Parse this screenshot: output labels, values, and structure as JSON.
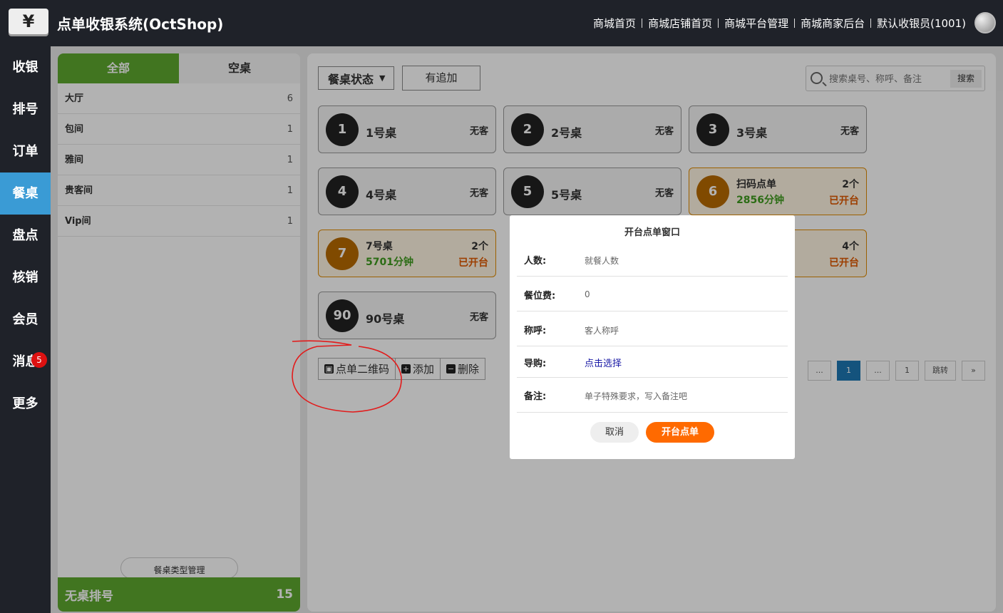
{
  "app": {
    "logo": "¥",
    "title": "点单收银系统(OctShop)"
  },
  "top_links": [
    "商城首页",
    "商城店铺首页",
    "商城平台管理",
    "商城商家后台",
    "默认收银员(1001)"
  ],
  "nav": [
    {
      "label": "收银"
    },
    {
      "label": "排号"
    },
    {
      "label": "订单"
    },
    {
      "label": "餐桌",
      "active": true
    },
    {
      "label": "盘点"
    },
    {
      "label": "核销"
    },
    {
      "label": "会员"
    },
    {
      "label": "消息",
      "badge": "5"
    },
    {
      "label": "更多"
    }
  ],
  "left_panel": {
    "tabs": [
      "全部",
      "空桌"
    ],
    "categories": [
      {
        "name": "大厅",
        "count": "6"
      },
      {
        "name": "包间",
        "count": "1"
      },
      {
        "name": "雅间",
        "count": "1"
      },
      {
        "name": "贵客间",
        "count": "1"
      },
      {
        "name": "Vip间",
        "count": "1"
      }
    ],
    "type_manage": "餐桌类型管理",
    "no_table_queue": {
      "label": "无桌排号",
      "count": "15"
    }
  },
  "toolbar": {
    "status_select": "餐桌状态",
    "append_button": "有追加",
    "search_placeholder": "搜索桌号、称呼、备注",
    "search_button": "搜索"
  },
  "tables": [
    {
      "num": "1",
      "name": "1号桌",
      "status": "无客"
    },
    {
      "num": "2",
      "name": "2号桌",
      "status": "无客"
    },
    {
      "num": "3",
      "name": "3号桌",
      "status": "无客"
    },
    {
      "num": "4",
      "name": "4号桌",
      "status": "无客"
    },
    {
      "num": "5",
      "name": "5号桌",
      "status": "无客"
    },
    {
      "num": "6",
      "name": "扫码点单",
      "minutes": "2856分钟",
      "count": "2个",
      "open": "已开台"
    },
    {
      "num": "7",
      "name": "7号桌",
      "minutes": "5701分钟",
      "count": "2个",
      "open": "已开台"
    },
    {
      "count": "4个",
      "open": "已开台"
    },
    {
      "num": "90",
      "name": "90号桌",
      "status": "无客"
    }
  ],
  "actions": {
    "qr": "点单二维码",
    "add": "添加",
    "delete": "删除"
  },
  "pager": [
    "...",
    "1",
    "...",
    "1",
    "跳转",
    "»"
  ],
  "modal": {
    "title": "开台点单窗口",
    "people_label": "人数:",
    "people_placeholder": "就餐人数",
    "seat_fee_label": "餐位费:",
    "seat_fee_value": "0",
    "name_label": "称呼:",
    "name_placeholder": "客人称呼",
    "guide_label": "导购:",
    "guide_link": "点击选择",
    "remark_label": "备注:",
    "remark_placeholder": "单子特殊要求，写入备注吧",
    "cancel": "取消",
    "confirm": "开台点单"
  },
  "colors": {
    "accent_green": "#5ea82f",
    "accent_blue": "#3a9bd5",
    "orange": "#ff6a00",
    "busy_border": "#e08a00"
  }
}
